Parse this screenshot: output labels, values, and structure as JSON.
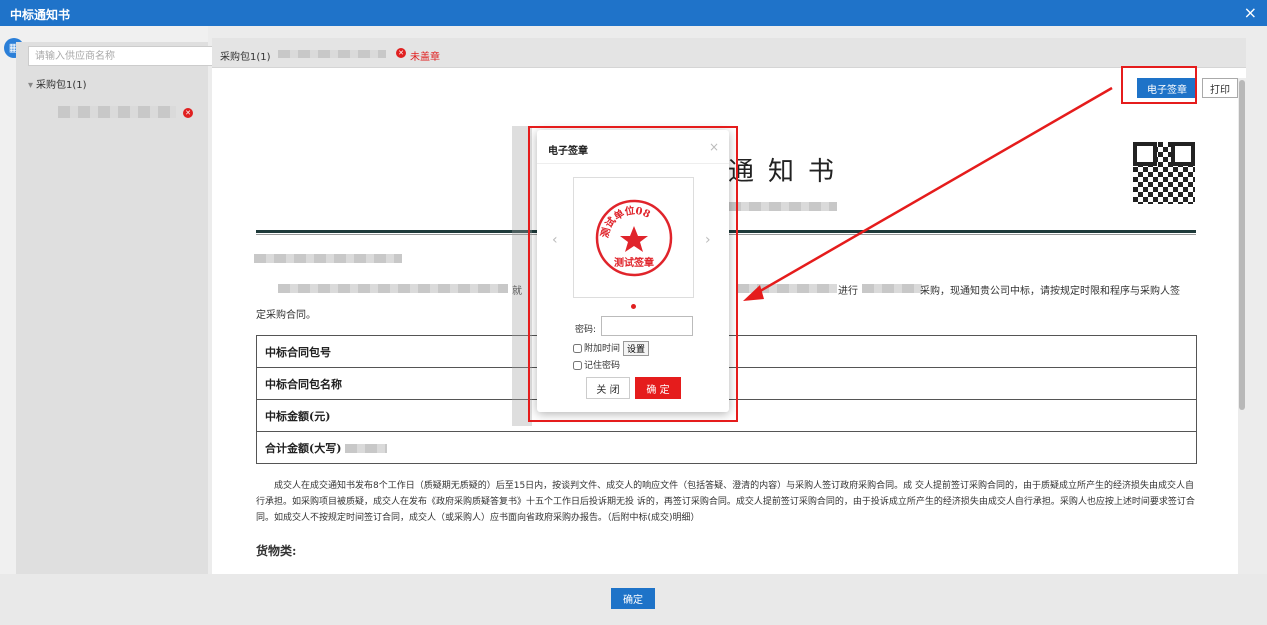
{
  "window": {
    "title": "中标通知书",
    "close": "×"
  },
  "sidebar": {
    "search_placeholder": "请输入供应商名称",
    "tree_node": "采购包1(1)",
    "child_status_icon": "red-x"
  },
  "tabbar": {
    "package_label": "采购包1(1)",
    "status": "未盖章"
  },
  "toolbar": {
    "sign_label": "电子签章",
    "print_label": "打印"
  },
  "document": {
    "title_suffix": "通知书",
    "para1_mid": "就",
    "para1_a": "进行",
    "para1_b": "采购，现通知贵公司中标，请按规定时限和程序与采购人签",
    "para1_line2": "定采购合同。",
    "table_rows": [
      "中标合同包号",
      "中标合同包名称",
      "中标金额(元)",
      "合计金额(大写)"
    ],
    "notice": "成交人在成交通知书发布8个工作日（质疑期无质疑的）后至15日内，按谈判文件、成交人的响应文件（包括答疑、澄清的内容）与采购人签订政府采购合同。成 交人提前签订采购合同的，由于质疑成立所产生的经济损失由成交人自行承担。如采购项目被质疑，成交人在发布《政府采购质疑答复书》十五个工作日后投诉期无投 诉的，再签订采购合同。成交人提前签订采购合同的，由于投诉成立所产生的经济损失由成交人自行承担。采购人也应按上述时间要求签订合同。如成交人不按规定时间签订合同，成交人（或采购人）应书面向省政府采购办报告。（后附中标(成交)明细）",
    "goods_heading": "货物类:"
  },
  "dialog": {
    "title": "电子签章",
    "close": "×",
    "stamp_ring_text": "测试单位08",
    "stamp_center_text": "测试签章",
    "prev": "‹",
    "next": "›",
    "password_label": "密码:",
    "attach_time_label": "附加时间",
    "set_label": "设置",
    "remember_label": "记住密码",
    "close_label": "关 闭",
    "ok_label": "确 定"
  },
  "footer": {
    "confirm_label": "确定"
  },
  "colors": {
    "primary": "#1e73c8",
    "danger": "#e51c1c",
    "titlebar": "#1f73c9"
  }
}
